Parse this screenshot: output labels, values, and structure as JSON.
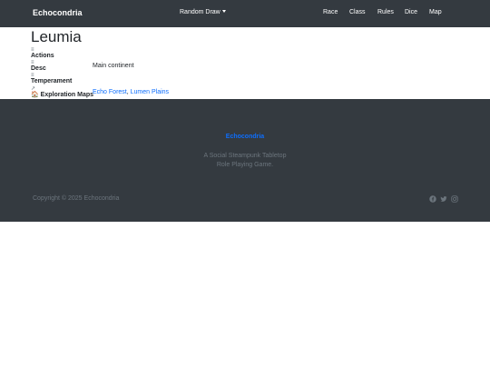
{
  "navbar": {
    "brand": "Echocondria",
    "dropdown_label": "Random Draw",
    "links": [
      "Race",
      "Class",
      "Rules",
      "Dice",
      "Map"
    ]
  },
  "page": {
    "title": "Leumia",
    "properties": [
      {
        "icon": "≡",
        "label": "Actions",
        "value": ""
      },
      {
        "icon": "≡",
        "label": "Desc",
        "value": "Main continent"
      },
      {
        "icon": "≡",
        "label": "Temperament",
        "value": ""
      },
      {
        "icon": "↗",
        "label": "Exploration Maps",
        "links": [
          "Echo Forest",
          "Lumen Plains"
        ],
        "separator": ", "
      }
    ]
  },
  "footer": {
    "brand": "Echocondria",
    "tagline_line1": "A Social Steampunk Tabletop",
    "tagline_line2": "Role Playing Game.",
    "copyright": "Copyright © 2025 Echocondria",
    "social_icons": [
      "facebook-icon",
      "twitter-icon",
      "instagram-icon"
    ]
  },
  "colors": {
    "navbar_bg": "#343a40",
    "footer_bg": "#343a40",
    "link": "#0d6efd",
    "muted": "#6c757d"
  }
}
